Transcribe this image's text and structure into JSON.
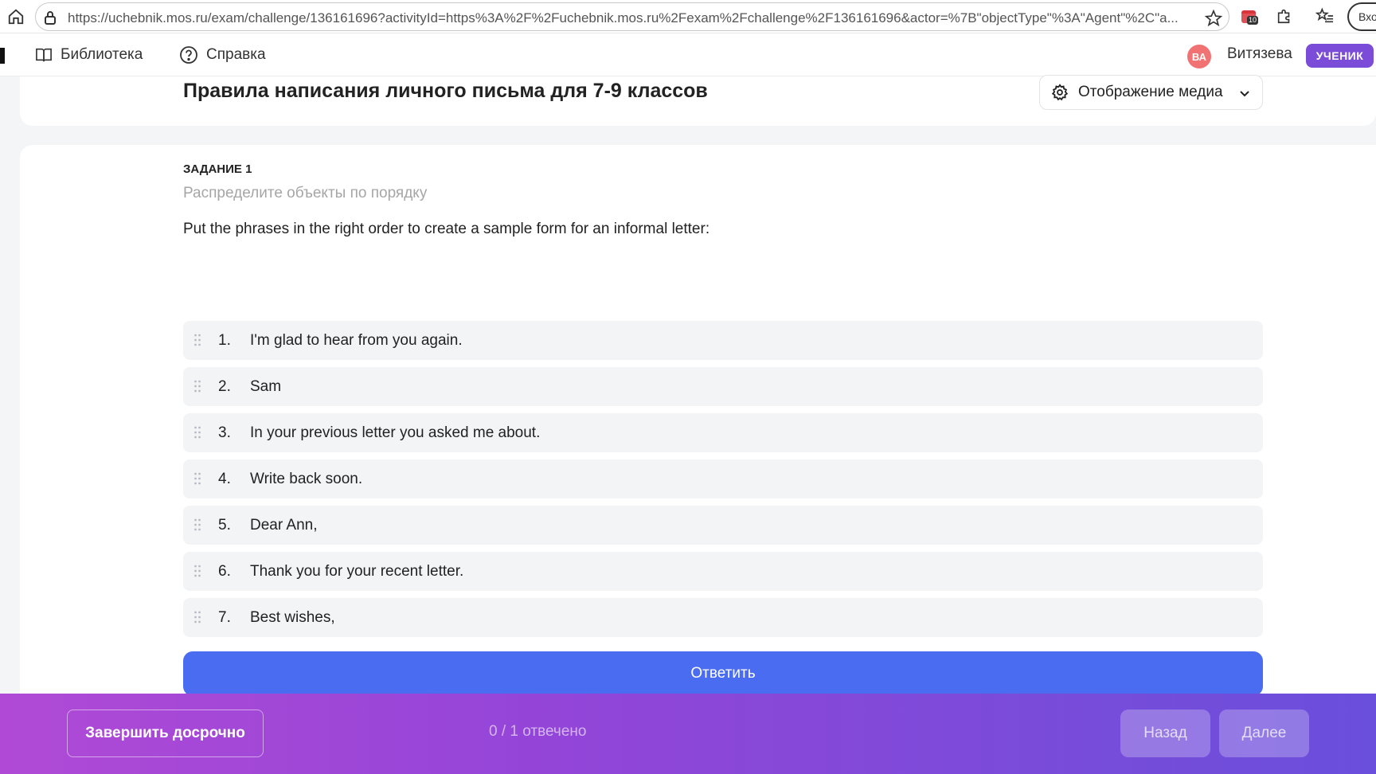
{
  "browser": {
    "url": "https://uchebnik.mos.ru/exam/challenge/136161696?activityId=https%3A%2F%2Fuchebnik.mos.ru%2Fexam%2Fchallenge%2F136161696&actor=%7B\"objectType\"%3A\"Agent\"%2C\"a...",
    "extension_badge": "10",
    "account_label": "Вход"
  },
  "nav": {
    "library_label": "Библиотека",
    "help_label": "Справка",
    "avatar_initials": "ВА",
    "user_name": "Витязева",
    "role_badge": "УЧЕНИК"
  },
  "header": {
    "title": "Правила написания личного письма для 7-9 классов",
    "media_button_label": "Отображение медиа"
  },
  "task": {
    "number_label": "ЗАДАНИЕ 1",
    "hint": "Распределите объекты по порядку",
    "question": "Put the phrases in the right order to create a sample form for an informal letter:",
    "items": [
      {
        "num": "1.",
        "text": "I'm glad to hear from you again."
      },
      {
        "num": "2.",
        "text": "Sam"
      },
      {
        "num": "3.",
        "text": "In your previous letter you asked me about."
      },
      {
        "num": "4.",
        "text": "Write back soon."
      },
      {
        "num": "5.",
        "text": "Dear Ann,"
      },
      {
        "num": "6.",
        "text": "Thank you for your recent letter."
      },
      {
        "num": "7.",
        "text": "Best wishes,"
      }
    ],
    "answer_button_label": "Ответить"
  },
  "footer": {
    "finish_button_label": "Завершить досрочно",
    "progress": "0 / 1 отвечено",
    "back_button_label": "Назад",
    "next_button_label": "Далее"
  },
  "colors": {
    "primary": "#4a6cf0",
    "role_badge": "#7b4cd8",
    "avatar": "#f07272",
    "footer_gradient_start": "#b04ad6",
    "footer_gradient_end": "#6a4fdc"
  }
}
